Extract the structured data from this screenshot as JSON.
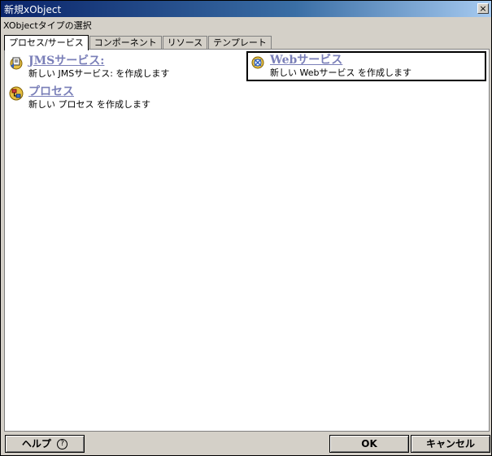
{
  "window": {
    "title": "新規xObject",
    "close_label": "×"
  },
  "subtitle": "XObjectタイプの選択",
  "tabs": [
    {
      "label": "プロセス/サービス"
    },
    {
      "label": "コンポーネント"
    },
    {
      "label": "リソース"
    },
    {
      "label": "テンプレート"
    }
  ],
  "items": {
    "jms": {
      "label": "JMSサービス:",
      "desc": "新しい JMSサービス: を作成します",
      "icon": "jms-service-icon"
    },
    "web": {
      "label": "Webサービス",
      "desc": "新しい Webサービス を作成します",
      "icon": "web-service-icon"
    },
    "process": {
      "label": "プロセス",
      "desc": "新しい プロセス を作成します",
      "icon": "process-icon"
    }
  },
  "footer": {
    "help_label": "ヘルプ",
    "help_glyph": "?",
    "ok_label": "OK",
    "cancel_label": "キャンセル"
  },
  "colors": {
    "title_bar": "#0a246a",
    "link_text": "#7a7fb8",
    "dialog_bg": "#d4d0c8"
  }
}
